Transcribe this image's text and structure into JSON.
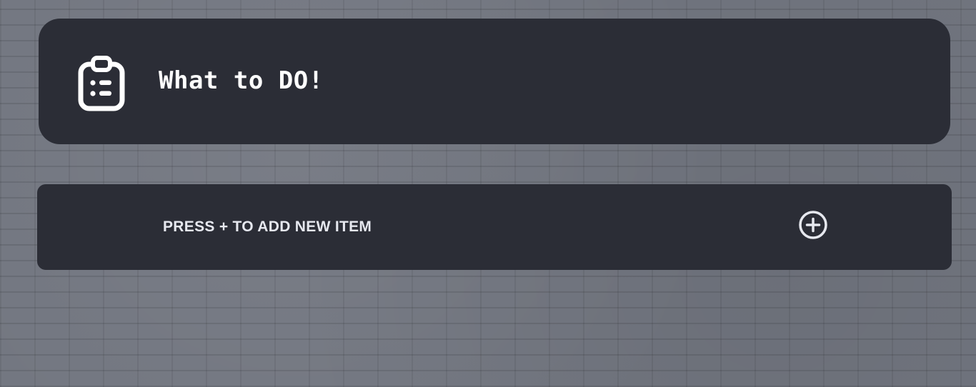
{
  "header": {
    "title": "What to DO!",
    "icon": "clipboard-list-icon"
  },
  "add_item": {
    "label": "PRESS + TO ADD NEW ITEM",
    "button_icon": "plus-circle-icon"
  },
  "colors": {
    "card_background": "#2b2d36",
    "page_background": "#727680",
    "text_primary": "#ffffff",
    "text_secondary": "#e6e8ef"
  }
}
